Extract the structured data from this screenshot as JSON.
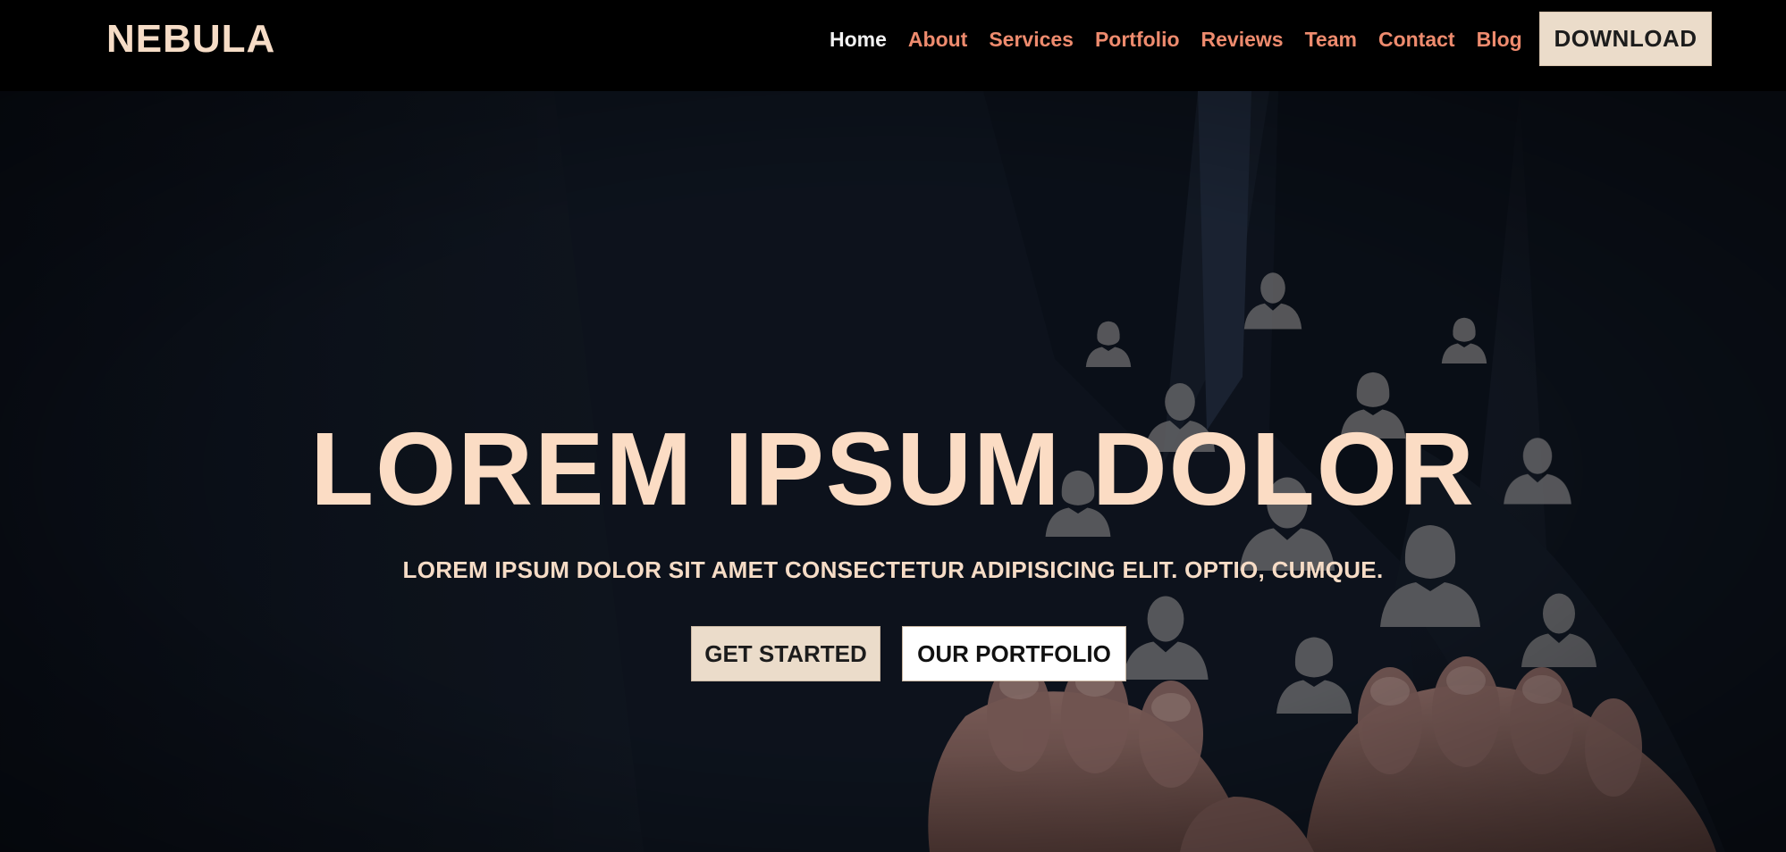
{
  "brand": {
    "name": "NEBULA"
  },
  "nav": {
    "items": [
      {
        "label": "Home",
        "active": true
      },
      {
        "label": "About"
      },
      {
        "label": "Services"
      },
      {
        "label": "Portfolio"
      },
      {
        "label": "Reviews"
      },
      {
        "label": "Team"
      },
      {
        "label": "Contact"
      },
      {
        "label": "Blog"
      }
    ],
    "download_label": "DOWNLOAD"
  },
  "hero": {
    "title": "LOREM IPSUM DOLOR",
    "subtitle": "LOREM IPSUM DOLOR SIT AMET CONSECTETUR ADIPISICING ELIT. OPTIO, CUMQUE.",
    "primary_button": "GET STARTED",
    "secondary_button": "OUR PORTFOLIO"
  },
  "colors": {
    "navbar_bg": "#000000",
    "brand_text": "#f6dcc6",
    "nav_link": "#ee8b6e",
    "nav_link_active": "#f2f2f2",
    "accent_button": "#ebdcca",
    "hero_title": "#fbdcc4"
  },
  "icons": {
    "hero_image": "people-network-in-hands-image"
  }
}
